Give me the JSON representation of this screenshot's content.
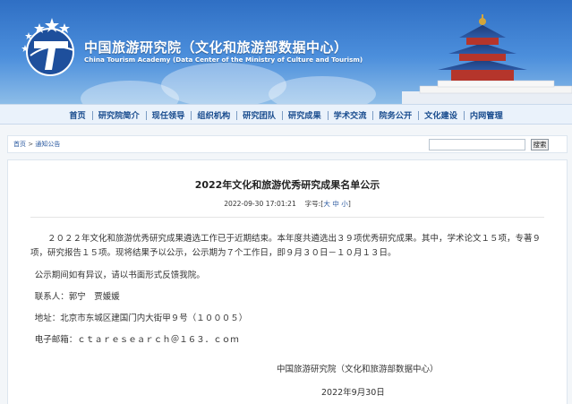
{
  "header": {
    "title_cn": "中国旅游研究院（文化和旅游部数据中心）",
    "title_en": "China Tourism Academy (Data Center of the Ministry of Culture and Tourism)"
  },
  "nav": {
    "items": [
      "首页",
      "研究院简介",
      "现任领导",
      "组织机构",
      "研究团队",
      "研究成果",
      "学术交流",
      "院务公开",
      "文化建设",
      "内网管理"
    ]
  },
  "breadcrumb": {
    "home": "首页",
    "separator": " > ",
    "current": "通知公告"
  },
  "search": {
    "placeholder": "",
    "button_label": "搜索"
  },
  "article": {
    "title": "2022年文化和旅游优秀研究成果名单公示",
    "datetime": "2022-09-30 17:01:21",
    "font_size_label": "字号:",
    "font_sizes": [
      "大",
      "中",
      "小"
    ],
    "paragraphs": [
      "２０２２年文化和旅游优秀研究成果遴选工作已于近期结束。本年度共遴选出３９项优秀研究成果。其中，学术论文１５项，专著９项，研究报告１５项。现将结果予以公示，公示期为７个工作日，即９月３０日－１０月１３日。",
      "公示期间如有异议，请以书面形式反馈我院。",
      "联系人：郭宁　贾媛媛",
      "地址：北京市东城区建国门内大街甲９号（１０００５）",
      "电子邮箱：ｃｔａｒｅｓｅａｒｃｈ＠１６３．ｃｏｍ"
    ],
    "signature_org": "中国旅游研究院（文化和旅游部数据中心）",
    "signature_date": "2022年9月30日"
  },
  "colors": {
    "nav_text": "#1a4d8f",
    "banner_blue": "#2f6fc4",
    "link": "#2b5aa0"
  }
}
